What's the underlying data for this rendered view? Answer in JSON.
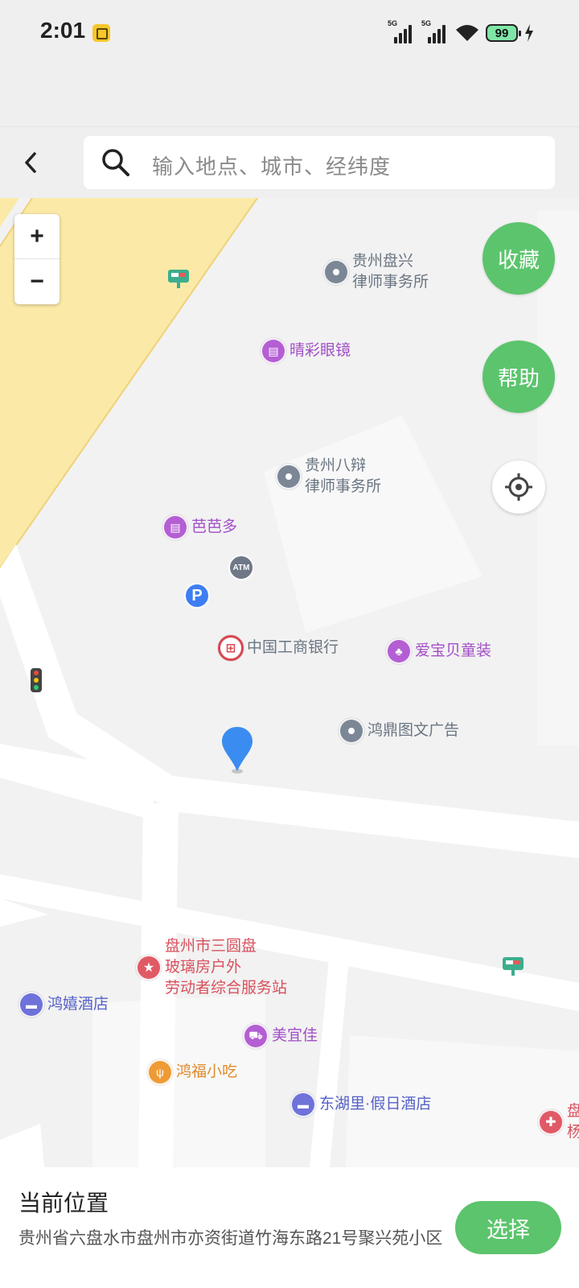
{
  "status_bar": {
    "time": "2:01",
    "signal_1_label": "5G",
    "signal_2_label": "5G",
    "battery_level": "99"
  },
  "search": {
    "placeholder": "输入地点、城市、经纬度"
  },
  "map": {
    "zoom_in_label": "+",
    "zoom_out_label": "−",
    "favorite_label": "收藏",
    "help_label": "帮助",
    "atm_label": "ATM",
    "parking_label": "P",
    "pois": {
      "guizhou_panxing_law": "贵州盘兴\n律师事务所",
      "qingcai_glasses": "晴彩眼镜",
      "guizhou_babian_law": "贵州八辩\n律师事务所",
      "bababa": "芭芭多",
      "icbc": "中国工商银行",
      "aibaobei": "爱宝贝童装",
      "hongding_ad": "鸿鼎图文广告",
      "sanyuanpan_station": "盘州市三圆盘\n玻璃房户外\n劳动者综合服务站",
      "hongxi_hotel": "鸿嬉酒店",
      "meiyijia": "美宜佳",
      "hongfu_snack": "鸿福小吃",
      "donghuli_hotel": "东湖里·假日酒店",
      "edge_poi": "盘\n杨"
    }
  },
  "bottom_panel": {
    "title": "当前位置",
    "address": "贵州省六盘水市盘州市亦资街道竹海东路21号聚兴苑小区",
    "select_label": "选择"
  },
  "colors": {
    "accent_green": "#5cc46d",
    "pin_blue": "#3b8cf0"
  }
}
